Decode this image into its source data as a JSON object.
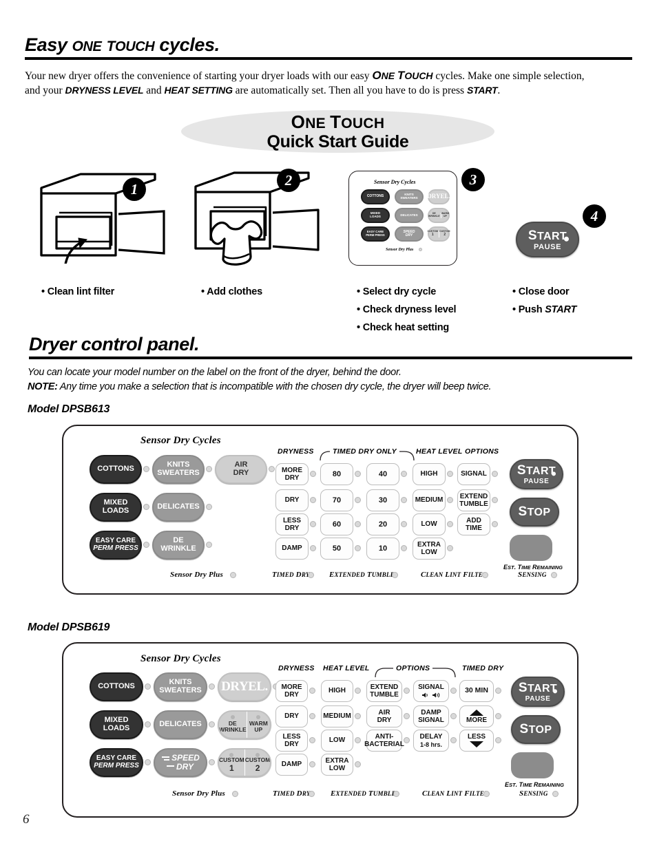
{
  "page_number": "6",
  "section1": {
    "heading_parts": [
      "Easy ",
      "O",
      "NE ",
      "T",
      "OUCH",
      " cycles."
    ],
    "heading_plain": "Easy ONE TOUCH cycles.",
    "paragraph_line1_a": "Your new dryer offers the convenience of starting your dryer loads with our easy ",
    "paragraph_one_touch": "ONE TOUCH",
    "paragraph_line1_b": " cycles. Make one simple selection,",
    "paragraph_line2_a": "and your ",
    "paragraph_dryness": "DRYNESS LEVEL",
    "paragraph_line2_b": " and ",
    "paragraph_heat": "HEAT SETTING",
    "paragraph_line2_c": " are automatically set. Then all you have to do is press ",
    "paragraph_start": "START",
    "paragraph_line2_d": "."
  },
  "quick_start": {
    "title_line1": "ONE TOUCH",
    "title_line2": "Quick Start Guide",
    "oval_color": "#e6e6e6",
    "steps": [
      {
        "number": "1",
        "bullets": [
          "Clean lint filter"
        ]
      },
      {
        "number": "2",
        "bullets": [
          "Add clothes"
        ]
      },
      {
        "number": "3",
        "bullets": [
          "Select dry cycle",
          "Check dryness level",
          "Check heat setting"
        ]
      },
      {
        "number": "4",
        "bullets": [
          "Close door",
          "Push START"
        ]
      }
    ],
    "step4_start_button": {
      "label_top": "START",
      "label_bottom": "PAUSE"
    },
    "mini_panel": {
      "title": "Sensor Dry Cycles",
      "footer": "Sensor Dry Plus",
      "cycles": [
        "COTTONS",
        "KNITS SWEATERS",
        "DRYEL.",
        "MIXED LOADS",
        "DELICATES",
        "DE WRINKLE",
        "WARM UP",
        "EASY CARE PERM PRESS",
        "SPEED DRY",
        "CUSTOM 1",
        "CUSTOM 2"
      ]
    }
  },
  "section2": {
    "heading": "Dryer control panel.",
    "note_line1": "You can locate your model number on the label on the front of the dryer, behind the door.",
    "note_label": "NOTE:",
    "note_line2": " Any time you make a selection that is incompatible with the chosen dry cycle, the dryer will beep twice."
  },
  "panel_613": {
    "model_label": "Model DPSB613",
    "cycles_title": "Sensor Dry Cycles",
    "cycles": [
      {
        "lines": [
          "COTTONS"
        ],
        "shade": "dark"
      },
      {
        "lines": [
          "KNITS",
          "SWEATERS"
        ],
        "shade": "mid"
      },
      {
        "lines": [
          "AIR",
          "DRY"
        ],
        "shade": "light"
      },
      {
        "lines": [
          "MIXED",
          "LOADS"
        ],
        "shade": "dark"
      },
      {
        "lines": [
          "DELICATES"
        ],
        "shade": "mid"
      },
      {
        "lines": [
          "EASY CARE",
          "PERM PRESS"
        ],
        "shade": "dark"
      },
      {
        "lines": [
          "DE",
          "WRINKLE"
        ],
        "shade": "mid"
      }
    ],
    "column_headers": {
      "dryness": "DRYNESS",
      "timed_dry_only": "TIMED DRY ONLY",
      "heat_level": "HEAT LEVEL",
      "options": "OPTIONS"
    },
    "dryness": [
      "MORE DRY",
      "DRY",
      "LESS DRY",
      "DAMP"
    ],
    "timed_col1": [
      "80",
      "70",
      "60",
      "50"
    ],
    "timed_col2": [
      "40",
      "30",
      "20",
      "10"
    ],
    "heat_level": [
      "HIGH",
      "MEDIUM",
      "LOW",
      "EXTRA LOW"
    ],
    "options": [
      "SIGNAL",
      "EXTEND TUMBLE",
      "ADD TIME"
    ],
    "start_button": {
      "label_top": "START",
      "label_bottom": "PAUSE"
    },
    "stop_button": "STOP",
    "display_label": "EST. TIME REMAINING",
    "status_labels": [
      "Sensor Dry Plus",
      "TIMED DRY",
      "EXTENDED TUMBLE",
      "CLEAN LINT FILTER",
      "SENSING"
    ]
  },
  "panel_619": {
    "model_label": "Model DPSB619",
    "cycles_title": "Sensor Dry Cycles",
    "cycles": [
      {
        "lines": [
          "COTTONS"
        ],
        "shade": "dark"
      },
      {
        "lines": [
          "KNITS",
          "SWEATERS"
        ],
        "shade": "mid"
      },
      {
        "lines": [
          "DRYEL."
        ],
        "shade": "light"
      },
      {
        "lines": [
          "MIXED",
          "LOADS"
        ],
        "shade": "dark"
      },
      {
        "lines": [
          "DELICATES"
        ],
        "shade": "mid"
      },
      {
        "lines": [
          "EASY CARE",
          "PERM PRESS"
        ],
        "shade": "dark"
      },
      {
        "lines": [
          "SPEED",
          "DRY"
        ],
        "shade": "mid"
      }
    ],
    "combo_top": [
      {
        "lines": [
          "DE",
          "WRINKLE"
        ]
      },
      {
        "lines": [
          "WARM",
          "UP"
        ]
      }
    ],
    "combo_bottom": [
      {
        "lines": [
          "CUSTOM",
          "1"
        ]
      },
      {
        "lines": [
          "CUSTOM",
          "2"
        ]
      }
    ],
    "column_headers": {
      "dryness": "DRYNESS",
      "heat_level": "HEAT LEVEL",
      "options": "OPTIONS",
      "timed_dry": "TIMED DRY"
    },
    "dryness": [
      "MORE DRY",
      "DRY",
      "LESS DRY",
      "DAMP"
    ],
    "heat_level": [
      "HIGH",
      "MEDIUM",
      "LOW",
      "EXTRA LOW"
    ],
    "options_col1": [
      "EXTEND TUMBLE",
      "AIR DRY",
      "ANTI- BACTERIAL"
    ],
    "options_col2": [
      "SIGNAL",
      "DAMP SIGNAL",
      "DELAY 1-8 hrs."
    ],
    "timed_dry": [
      "30 MIN",
      "MORE",
      "LESS"
    ],
    "start_button": {
      "label_top": "START",
      "label_bottom": "PAUSE"
    },
    "stop_button": "STOP",
    "display_label": "EST. TIME REMAINING",
    "status_labels": [
      "Sensor Dry Plus",
      "TIMED DRY",
      "EXTENDED TUMBLE",
      "CLEAN LINT FILTER",
      "SENSING"
    ]
  }
}
